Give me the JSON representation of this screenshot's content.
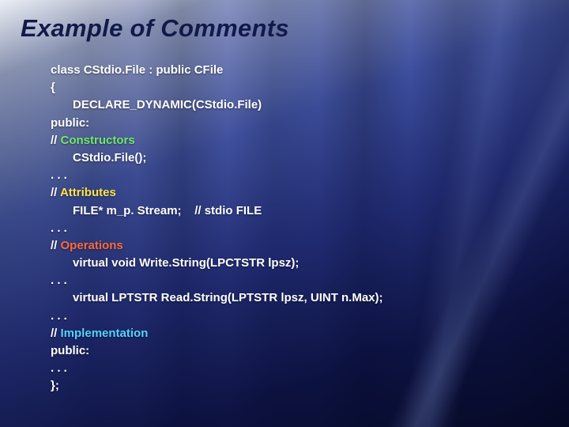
{
  "title": "Example of Comments",
  "code": {
    "l1": "class CStdio.File : public CFile",
    "l2": "{",
    "l3": "DECLARE_DYNAMIC(CStdio.File)",
    "l4": "public:",
    "l5_prefix": "// ",
    "l5_kw": "Constructors",
    "l6": "CStdio.File();",
    "l7": ". . .",
    "l8_prefix": "// ",
    "l8_kw": "Attributes",
    "l9": "FILE* m_p. Stream;    // stdio FILE",
    "l10": ". . .",
    "l11_prefix": "// ",
    "l11_kw": "Operations",
    "l12": "virtual void Write.String(LPCTSTR lpsz);",
    "l13": ". . .",
    "l14": "virtual LPTSTR Read.String(LPTSTR lpsz, UINT n.Max);",
    "l15": ". . .",
    "l16_prefix": "// ",
    "l16_kw": "Implementation",
    "l17": "public:",
    "l18": ". . .",
    "l19": "};"
  }
}
